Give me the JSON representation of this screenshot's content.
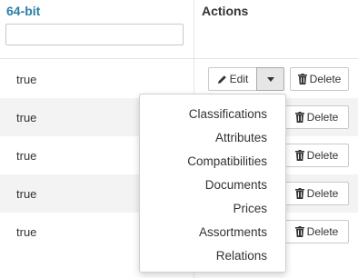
{
  "columns": {
    "bit64": "64-bit",
    "actions": "Actions"
  },
  "filter": {
    "value": "",
    "placeholder": ""
  },
  "rows": [
    {
      "value": "true"
    },
    {
      "value": "true"
    },
    {
      "value": "true"
    },
    {
      "value": "true"
    },
    {
      "value": "true"
    }
  ],
  "buttons": {
    "edit": "Edit",
    "delete": "Delete"
  },
  "icons": {
    "edit": "pencil-icon",
    "dropdown": "caret-down-icon",
    "delete": "trash-icon"
  },
  "menu": {
    "items": [
      "Classifications",
      "Attributes",
      "Compatibilities",
      "Documents",
      "Prices",
      "Assortments",
      "Relations"
    ]
  }
}
